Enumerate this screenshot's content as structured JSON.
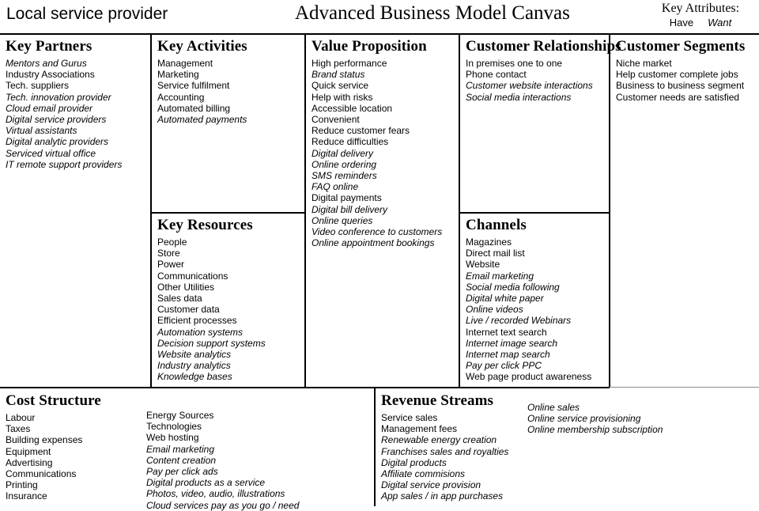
{
  "header": {
    "doc_title": "Local service provider",
    "canvas_title": "Advanced Business Model Canvas",
    "legend_title": "Key Attributes:",
    "legend_have": "Have",
    "legend_want": "Want"
  },
  "blocks": {
    "key_partners": {
      "title": "Key Partners",
      "items": [
        {
          "text": "Mentors and Gurus",
          "attr": "want"
        },
        {
          "text": "Industry Associations",
          "attr": "have"
        },
        {
          "text": "Tech. suppliers",
          "attr": "have"
        },
        {
          "text": "Tech. innovation provider",
          "attr": "want"
        },
        {
          "text": "Cloud email provider",
          "attr": "want"
        },
        {
          "text": "Digital service providers",
          "attr": "want"
        },
        {
          "text": "Virtual assistants",
          "attr": "want"
        },
        {
          "text": "Digital analytic providers",
          "attr": "want"
        },
        {
          "text": "Serviced virtual office",
          "attr": "want"
        },
        {
          "text": "IT remote support providers",
          "attr": "want"
        }
      ]
    },
    "key_activities": {
      "title": "Key Activities",
      "items": [
        {
          "text": "Management",
          "attr": "have"
        },
        {
          "text": "Marketing",
          "attr": "have"
        },
        {
          "text": "Service fulfilment",
          "attr": "have"
        },
        {
          "text": "Accounting",
          "attr": "have"
        },
        {
          "text": "Automated billing",
          "attr": "have"
        },
        {
          "text": "Automated payments",
          "attr": "want"
        }
      ]
    },
    "key_resources": {
      "title": "Key Resources",
      "items": [
        {
          "text": "People",
          "attr": "have"
        },
        {
          "text": "Store",
          "attr": "have"
        },
        {
          "text": "Power",
          "attr": "have"
        },
        {
          "text": "Communications",
          "attr": "have"
        },
        {
          "text": "Other Utilities",
          "attr": "have"
        },
        {
          "text": "Sales data",
          "attr": "have"
        },
        {
          "text": "Customer data",
          "attr": "have"
        },
        {
          "text": "Efficient processes",
          "attr": "have"
        },
        {
          "text": "Automation systems",
          "attr": "want"
        },
        {
          "text": "Decision support systems",
          "attr": "want"
        },
        {
          "text": "Website analytics",
          "attr": "want"
        },
        {
          "text": "Industry analytics",
          "attr": "want"
        },
        {
          "text": "Knowledge bases",
          "attr": "want"
        }
      ]
    },
    "value_proposition": {
      "title": "Value Proposition",
      "items": [
        {
          "text": "High performance",
          "attr": "have"
        },
        {
          "text": "Brand status",
          "attr": "want"
        },
        {
          "text": "Quick service",
          "attr": "have"
        },
        {
          "text": "Help with risks",
          "attr": "have"
        },
        {
          "text": "Accessible location",
          "attr": "have"
        },
        {
          "text": "Convenient",
          "attr": "have"
        },
        {
          "text": "Reduce customer fears",
          "attr": "have"
        },
        {
          "text": "Reduce difficulties",
          "attr": "have"
        },
        {
          "text": "Digital delivery",
          "attr": "want"
        },
        {
          "text": "Online ordering",
          "attr": "want"
        },
        {
          "text": "SMS reminders",
          "attr": "want"
        },
        {
          "text": "FAQ online",
          "attr": "want"
        },
        {
          "text": "Digital payments",
          "attr": "have"
        },
        {
          "text": "Digital bill delivery",
          "attr": "want"
        },
        {
          "text": "Online queries",
          "attr": "want"
        },
        {
          "text": "Video conference to customers",
          "attr": "want"
        },
        {
          "text": "Online appointment bookings",
          "attr": "want"
        }
      ]
    },
    "customer_relationships": {
      "title": "Customer Relationships",
      "items": [
        {
          "text": "In premises one to one",
          "attr": "have"
        },
        {
          "text": "Phone contact",
          "attr": "have"
        },
        {
          "text": "Customer website interactions",
          "attr": "want"
        },
        {
          "text": "Social media interactions",
          "attr": "want"
        }
      ]
    },
    "channels": {
      "title": "Channels",
      "items": [
        {
          "text": "Magazines",
          "attr": "have"
        },
        {
          "text": "Direct mail list",
          "attr": "have"
        },
        {
          "text": "Website",
          "attr": "have"
        },
        {
          "text": "Email marketing",
          "attr": "want"
        },
        {
          "text": "Social media following",
          "attr": "want"
        },
        {
          "text": "Digital white paper",
          "attr": "want"
        },
        {
          "text": "Online videos",
          "attr": "want"
        },
        {
          "text": "Live / recorded Webinars",
          "attr": "want"
        },
        {
          "text": "Internet text search",
          "attr": "have"
        },
        {
          "text": "Internet image search",
          "attr": "want"
        },
        {
          "text": "Internet map search",
          "attr": "want"
        },
        {
          "text": "Pay per click PPC",
          "attr": "want"
        },
        {
          "text": "Web page product awareness",
          "attr": "have"
        }
      ]
    },
    "customer_segments": {
      "title": "Customer Segments",
      "items": [
        {
          "text": "Niche market",
          "attr": "have"
        },
        {
          "text": "Help customer complete jobs",
          "attr": "have"
        },
        {
          "text": "Business to business segment",
          "attr": "have"
        },
        {
          "text": "Customer needs are satisfied",
          "attr": "have"
        }
      ]
    },
    "cost_structure": {
      "title": "Cost Structure",
      "items_left": [
        {
          "text": "Labour",
          "attr": "have"
        },
        {
          "text": "Taxes",
          "attr": "have"
        },
        {
          "text": "Building expenses",
          "attr": "have"
        },
        {
          "text": "Equipment",
          "attr": "have"
        },
        {
          "text": "Advertising",
          "attr": "have"
        },
        {
          "text": "Communications",
          "attr": "have"
        },
        {
          "text": "Printing",
          "attr": "have"
        },
        {
          "text": "Insurance",
          "attr": "have"
        }
      ],
      "items_right": [
        {
          "text": "Energy Sources",
          "attr": "have"
        },
        {
          "text": "Technologies",
          "attr": "have"
        },
        {
          "text": "Web hosting",
          "attr": "have"
        },
        {
          "text": "Email marketing",
          "attr": "want"
        },
        {
          "text": "Content creation",
          "attr": "want"
        },
        {
          "text": "Pay per click ads",
          "attr": "want"
        },
        {
          "text": "Digital products as a service",
          "attr": "want"
        },
        {
          "text": "Photos, video, audio, illustrations",
          "attr": "want"
        },
        {
          "text": "Cloud services pay as you go / need",
          "attr": "want"
        }
      ]
    },
    "revenue_streams": {
      "title": "Revenue Streams",
      "items_left": [
        {
          "text": "Service sales",
          "attr": "have"
        },
        {
          "text": "Management fees",
          "attr": "have"
        },
        {
          "text": "Renewable energy creation",
          "attr": "want"
        },
        {
          "text": "Franchises sales and royalties",
          "attr": "want"
        },
        {
          "text": "Digital products",
          "attr": "want"
        },
        {
          "text": "Affiliate commisions",
          "attr": "want"
        },
        {
          "text": "Digital service provision",
          "attr": "want"
        },
        {
          "text": "App sales / in app purchases",
          "attr": "want"
        }
      ],
      "items_right": [
        {
          "text": "Online sales",
          "attr": "want"
        },
        {
          "text": "Online service provisioning",
          "attr": "want"
        },
        {
          "text": "Online membership subscription",
          "attr": "want"
        }
      ]
    }
  }
}
